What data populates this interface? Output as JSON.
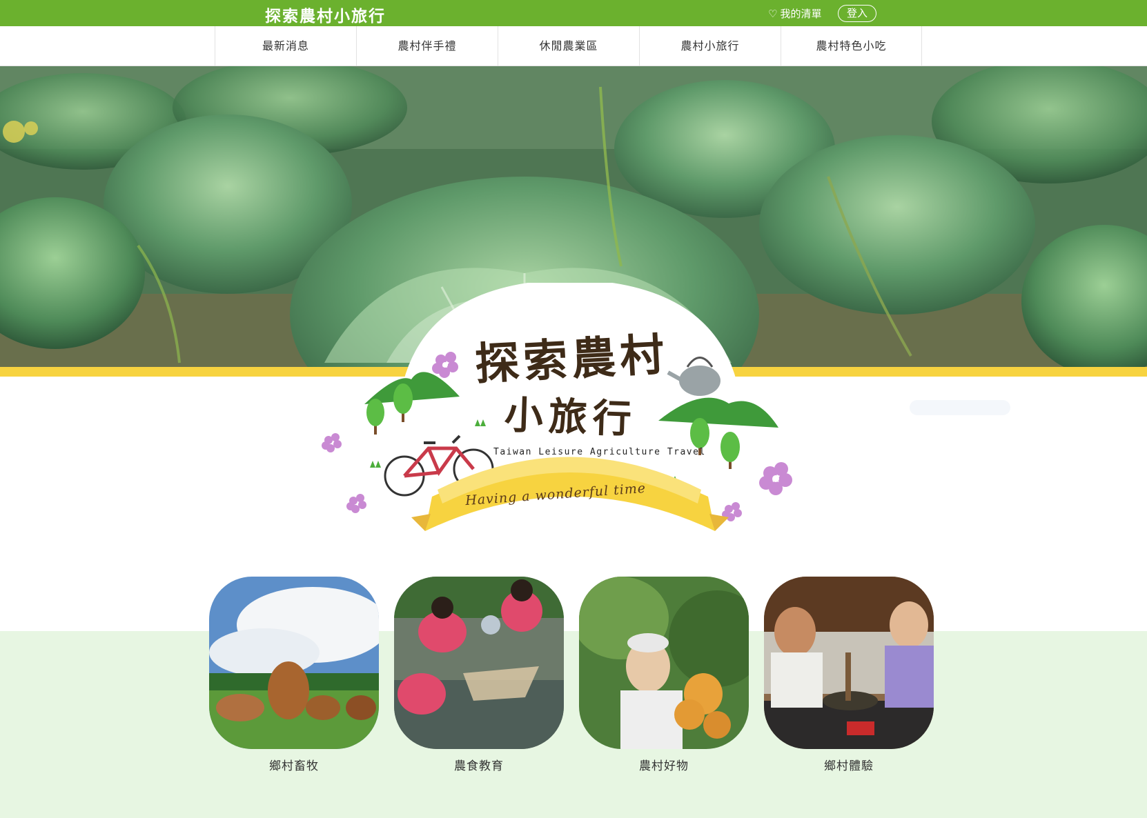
{
  "header": {
    "site_title": "探索農村小旅行",
    "wishlist_label": "我的清單",
    "login_label": "登入"
  },
  "nav": {
    "items": [
      {
        "label": "最新消息"
      },
      {
        "label": "農村伴手禮"
      },
      {
        "label": "休閒農業區"
      },
      {
        "label": "農村小旅行"
      },
      {
        "label": "農村特色小吃"
      }
    ]
  },
  "badge": {
    "title_line1": "探索農村",
    "title_line2": "小旅行",
    "subtitle_en": "Taiwan Leisure Agriculture Travel",
    "ribbon": "Having a wonderful time"
  },
  "categories": [
    {
      "label": "鄉村畜牧",
      "icon": "cows-photo"
    },
    {
      "label": "農食教育",
      "icon": "stream-fishing-photo"
    },
    {
      "label": "農村好物",
      "icon": "fruit-farmer-photo"
    },
    {
      "label": "鄉村體驗",
      "icon": "grinding-tea-photo"
    }
  ],
  "colors": {
    "brand_green": "#6bb12e",
    "accent_yellow": "#f7d340",
    "lower_band": "#e7f6e2"
  }
}
